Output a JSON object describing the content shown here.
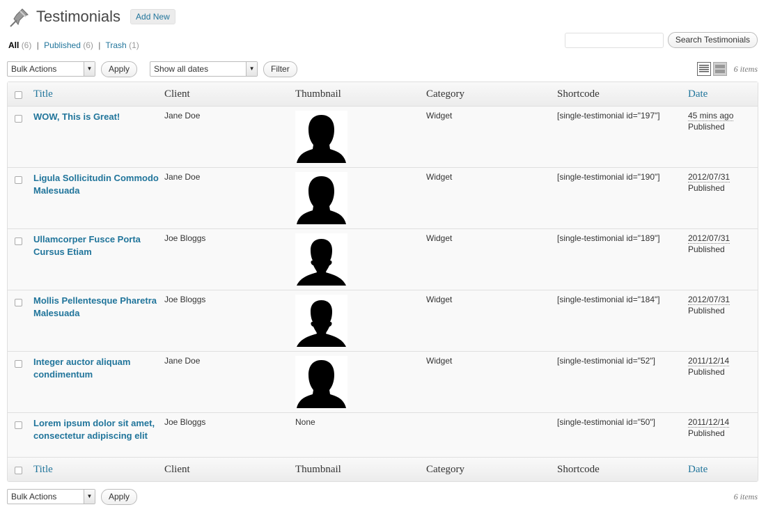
{
  "header": {
    "title": "Testimonials",
    "add_new_label": "Add New"
  },
  "views": [
    {
      "label": "All",
      "count": "(6)"
    },
    {
      "label": "Published",
      "count": "(6)"
    },
    {
      "label": "Trash",
      "count": "(1)"
    }
  ],
  "search": {
    "button_label": "Search Testimonials",
    "value": ""
  },
  "tablenav": {
    "bulk_actions": "Bulk Actions",
    "apply_label": "Apply",
    "dates_filter": "Show all dates",
    "filter_label": "Filter",
    "items_count": "6 items"
  },
  "columns": [
    "Title",
    "Client",
    "Thumbnail",
    "Category",
    "Shortcode",
    "Date"
  ],
  "rows": [
    {
      "title": "WOW, This is Great!",
      "client": "Jane Doe",
      "thumbnail": "female-silhouette",
      "thumb_text": "",
      "category": "Widget",
      "shortcode": "[single-testimonial id=\"197\"]",
      "date": "45 mins ago",
      "status": "Published"
    },
    {
      "title": "Ligula Sollicitudin Commodo Malesuada",
      "client": "Jane Doe",
      "thumbnail": "female-silhouette",
      "thumb_text": "",
      "category": "Widget",
      "shortcode": "[single-testimonial id=\"190\"]",
      "date": "2012/07/31",
      "status": "Published"
    },
    {
      "title": "Ullamcorper Fusce Porta Cursus Etiam",
      "client": "Joe Bloggs",
      "thumbnail": "male-silhouette",
      "thumb_text": "",
      "category": "Widget",
      "shortcode": "[single-testimonial id=\"189\"]",
      "date": "2012/07/31",
      "status": "Published"
    },
    {
      "title": "Mollis Pellentesque Pharetra Malesuada",
      "client": "Joe Bloggs",
      "thumbnail": "male-silhouette",
      "thumb_text": "",
      "category": "Widget",
      "shortcode": "[single-testimonial id=\"184\"]",
      "date": "2012/07/31",
      "status": "Published"
    },
    {
      "title": "Integer auctor aliquam condimentum",
      "client": "Jane Doe",
      "thumbnail": "female-silhouette",
      "thumb_text": "",
      "category": "Widget",
      "shortcode": "[single-testimonial id=\"52\"]",
      "date": "2011/12/14",
      "status": "Published"
    },
    {
      "title": "Lorem ipsum dolor sit amet, consectetur adipiscing elit",
      "client": "Joe Bloggs",
      "thumbnail": "none",
      "thumb_text": "None",
      "category": "",
      "shortcode": "[single-testimonial id=\"50\"]",
      "date": "2011/12/14",
      "status": "Published"
    }
  ],
  "colors": {
    "link": "#21759b",
    "text": "#333333",
    "border": "#dfdfdf",
    "header_bg": "#ececec"
  }
}
